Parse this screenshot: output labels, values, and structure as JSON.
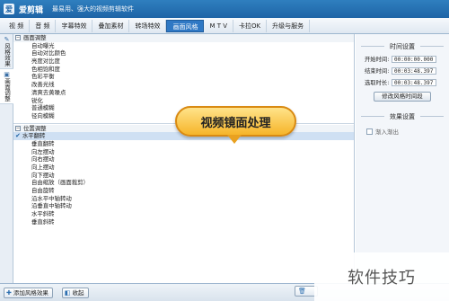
{
  "app": {
    "title": "爱剪辑",
    "slogan": "最易用、强大的视频剪辑软件",
    "logo_glyph": "爱"
  },
  "tabs": [
    {
      "label": "视 频"
    },
    {
      "label": "音 频"
    },
    {
      "label": "字幕特效"
    },
    {
      "label": "叠加素材"
    },
    {
      "label": "转场特效"
    },
    {
      "label": "画面风格",
      "active": true
    },
    {
      "label": "M T V"
    },
    {
      "label": "卡拉OK"
    },
    {
      "label": "升级与服务"
    }
  ],
  "sidebar": {
    "items": [
      {
        "label": "风格效果",
        "icon": "brush-icon"
      },
      {
        "label": "画面调整",
        "icon": "image-icon",
        "active": true
      }
    ]
  },
  "list": {
    "group1": {
      "label": "画面调整",
      "toggle": "−"
    },
    "group1_items": [
      "自动曝光",
      "自动对比颜色",
      "亮度对比度",
      "色相饱和度",
      "色彩平衡",
      "改善光线",
      "清爽去黄噪点",
      "锐化",
      "普通模糊",
      "径向模糊"
    ],
    "group2": {
      "label": "位置调整",
      "toggle": "−"
    },
    "selected_item": "水平翻转",
    "group2_items": [
      "垂直翻转",
      "向左摆动",
      "向右摆动",
      "向上摆动",
      "向下摆动",
      "自由缩放（画面裁剪）",
      "自由旋转",
      "沿水平中轴转动",
      "沿垂直中轴转动",
      "水平斜转",
      "垂直斜转"
    ]
  },
  "callout": {
    "text": "视频镜面处理"
  },
  "right_panel": {
    "time_section_title": "时间设置",
    "start_label": "开始时间:",
    "start_value": "00:00:00.000",
    "end_label": "结束时间:",
    "end_value": "00:03:48.397",
    "duration_label": "选取时长:",
    "duration_value": "00:03:48.397",
    "modify_button": "修改风格时间段",
    "fade_section_title": "效果设置",
    "fade_label": "渐入渐出"
  },
  "bottom": {
    "add_button": "添加风格效果",
    "delete_button": "收起",
    "partial_icon": "trash-icon"
  },
  "watermark": {
    "text": "软件技巧"
  }
}
